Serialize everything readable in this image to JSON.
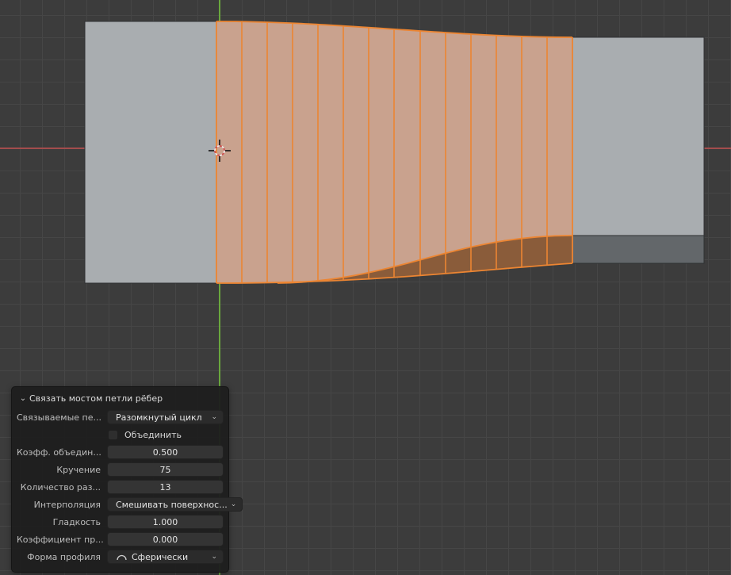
{
  "viewport": {
    "bg_color": "#3c3c3c",
    "grid_color": "#464646",
    "axis_x_color": "#a34c4c",
    "axis_y_color": "#6aa83e",
    "mesh": {
      "face_color": "#a9adb0",
      "face_shaded_color": "#63676a",
      "selected_face_color": "#c9a28e",
      "selected_face_shaded_color": "#8a5c3a",
      "selected_edge_color": "#ec8532",
      "segments": 14
    }
  },
  "icons": {
    "chevron_down": "⌄"
  },
  "panel": {
    "title": "Связать мостом петли рёбер",
    "rows": [
      {
        "label": "Связываемые пе...",
        "type": "dropdown",
        "value": "Разомкнутый цикл"
      },
      {
        "label": "Объединить",
        "type": "checkbox",
        "checked": false
      },
      {
        "label": "Коэфф. объедин...",
        "type": "number",
        "value": "0.500"
      },
      {
        "label": "Кручение",
        "type": "number",
        "value": "75"
      },
      {
        "label": "Количество раз...",
        "type": "number",
        "value": "13"
      },
      {
        "label": "Интерполяция",
        "type": "dropdown",
        "value": "Смешивать поверхнос..."
      },
      {
        "label": "Гладкость",
        "type": "number",
        "value": "1.000"
      },
      {
        "label": "Коэффициент пр...",
        "type": "number",
        "value": "0.000"
      },
      {
        "label": "Форма профиля",
        "type": "dropdown",
        "value": "Сферически",
        "icon": "profile-curve"
      }
    ]
  }
}
